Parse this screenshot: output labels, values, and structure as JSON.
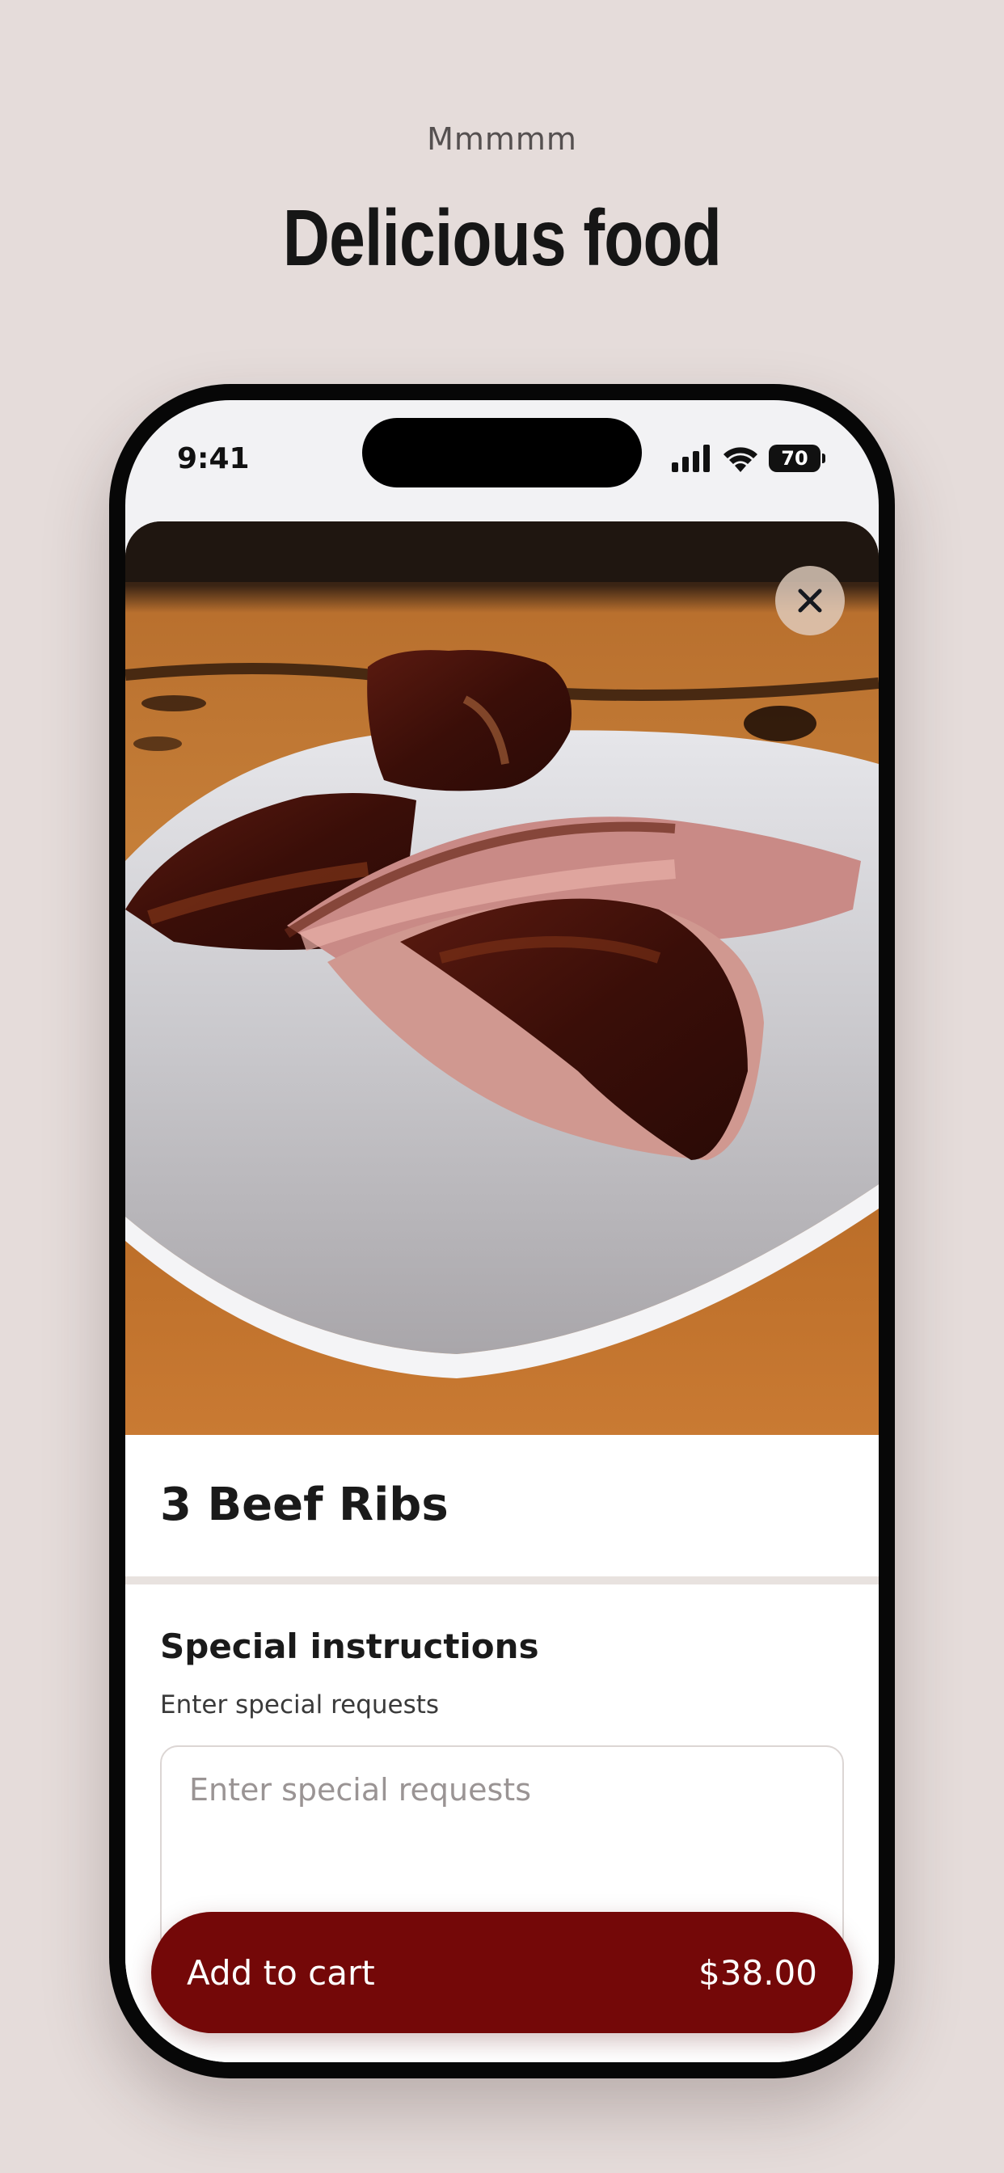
{
  "header": {
    "eyebrow": "Mmmmm",
    "headline": "Delicious food"
  },
  "status_bar": {
    "time": "9:41",
    "battery_level": "70",
    "icons": [
      "cellular-signal-icon",
      "wifi-icon",
      "battery-icon"
    ]
  },
  "item": {
    "image_icon": "food-photo-ribs",
    "title": "3 Beef Ribs",
    "close_icon": "close-icon"
  },
  "special_instructions": {
    "title": "Special instructions",
    "label": "Enter special requests",
    "placeholder": "Enter special requests",
    "value": ""
  },
  "cart_button": {
    "label": "Add to cart",
    "price": "$38.00"
  },
  "colors": {
    "background": "#e5dcda",
    "accent": "#740808",
    "text": "#161616"
  }
}
